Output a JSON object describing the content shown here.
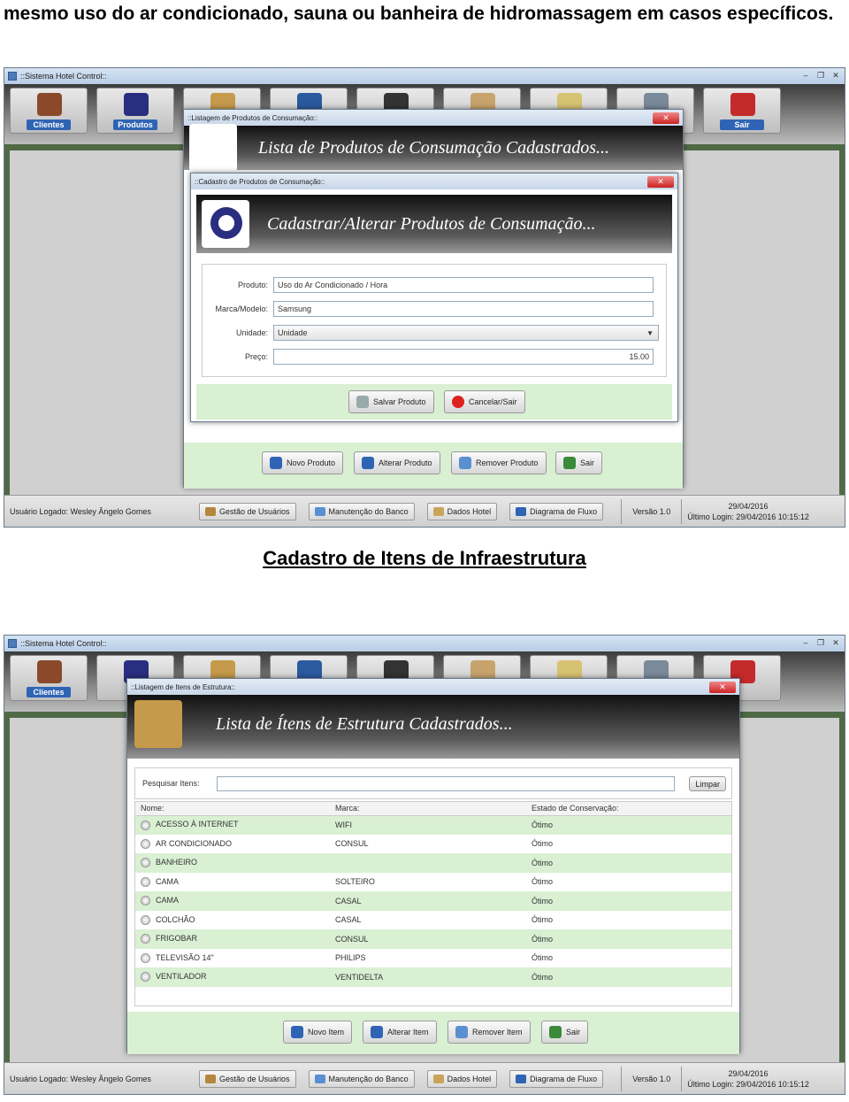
{
  "intro_text": "mesmo uso do ar condicionado, sauna ou banheira de hidromassagem em casos específicos.",
  "section_heading": "Cadastro de Itens de Infraestrutura",
  "app": {
    "title": "::Sistema Hotel Control::",
    "toolbar": [
      {
        "label": "Clientes",
        "color": "#2f64b5"
      },
      {
        "label": "Produtos",
        "color": "#2f64b5"
      },
      {
        "label": "",
        "color": "#2f64b5"
      },
      {
        "label": "",
        "color": "#2f64b5"
      },
      {
        "label": "",
        "color": "#2f64b5"
      },
      {
        "label": "",
        "color": "#2f64b5"
      },
      {
        "label": "",
        "color": "#2f64b5"
      },
      {
        "label": "",
        "color": "#2f64b5"
      },
      {
        "label": "Sair",
        "color": "#2f64b5"
      }
    ],
    "status": {
      "user": "Usuário Logado: Wesley Ângelo Gomes",
      "buttons": [
        "Gestão de Usuários",
        "Manutenção do Banco",
        "Dados Hotel",
        "Diagrama de Fluxo"
      ],
      "version": "Versão 1.0",
      "date": "29/04/2016",
      "last_login_1": "Último Login: 29/04/2016 10:15:12",
      "last_login_2": "Último Login: 29/04/2016 10:15:12"
    }
  },
  "screen1": {
    "list_dialog_title": "::Listagem de Produtos de Consumação::",
    "list_banner": "Lista de Produtos de Consumação Cadastrados...",
    "form_dialog_title": "::Cadastro de Produtos de Consumação::",
    "form_banner": "Cadastrar/Alterar Produtos de Consumação...",
    "fields": [
      {
        "label": "Produto:",
        "value": "Uso do Ar Condicionado / Hora"
      },
      {
        "label": "Marca/Modelo:",
        "value": "Samsung"
      },
      {
        "label": "Unidade:",
        "value": "Unidade"
      },
      {
        "label": "Preço:",
        "value": "15.00"
      }
    ],
    "form_buttons": [
      "Salvar Produto",
      "Cancelar/Sair"
    ],
    "list_buttons": [
      "Novo Produto",
      "Alterar Produto",
      "Remover Produto",
      "Sair"
    ]
  },
  "screen2": {
    "dialog_title": "::Listagem de Itens de Estrutura::",
    "banner": "Lista de Ítens de Estrutura Cadastrados...",
    "search_label": "Pesquisar Itens:",
    "clear_button": "Limpar",
    "columns": [
      "Nome:",
      "Marca:",
      "Estado de Conservação:"
    ],
    "rows": [
      [
        "ACESSO À INTERNET",
        "WIFI",
        "Ótimo"
      ],
      [
        "AR CONDICIONADO",
        "CONSUL",
        "Ótimo"
      ],
      [
        "BANHEIRO",
        "",
        "Ótimo"
      ],
      [
        "CAMA",
        "SOLTEIRO",
        "Ótimo"
      ],
      [
        "CAMA",
        "CASAL",
        "Ótimo"
      ],
      [
        "COLCHÃO",
        "CASAL",
        "Ótimo"
      ],
      [
        "FRIGOBAR",
        "CONSUL",
        "Ótimo"
      ],
      [
        "TELEVISÃO 14\"",
        "PHILIPS",
        "Ótimo"
      ],
      [
        "VENTILADOR",
        "VENTIDELTA",
        "Ótimo"
      ]
    ],
    "buttons": [
      "Novo Item",
      "Alterar Item",
      "Remover Item",
      "Sair"
    ]
  }
}
